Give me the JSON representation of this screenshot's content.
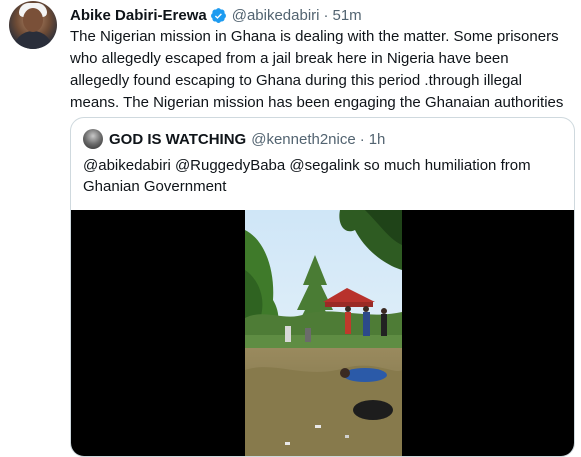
{
  "tweet": {
    "author_name": "Abike Dabiri-Erewa",
    "handle": "@abikedabiri",
    "separator": "·",
    "time": "51m",
    "text": "The Nigerian mission in Ghana is dealing with the matter. Some prisoners who allegedly escaped from a jail break here in Nigeria have been allegedly found escaping to Ghana during this period .through illegal means. The Nigerian mission has been engaging the Ghanaian authorities"
  },
  "quoted_tweet": {
    "author_name": "GOD IS WATCHING",
    "handle": "@kenneth2nice",
    "separator": "·",
    "time": "1h",
    "text": "@abikedabiri  @RuggedyBaba @segalink so much humiliation from Ghanian Government"
  },
  "colors": {
    "verified": "#1d9bf0",
    "secondary_text": "#536471",
    "border": "#cfd9de"
  },
  "icons": {
    "verified": "verified-badge-icon"
  }
}
